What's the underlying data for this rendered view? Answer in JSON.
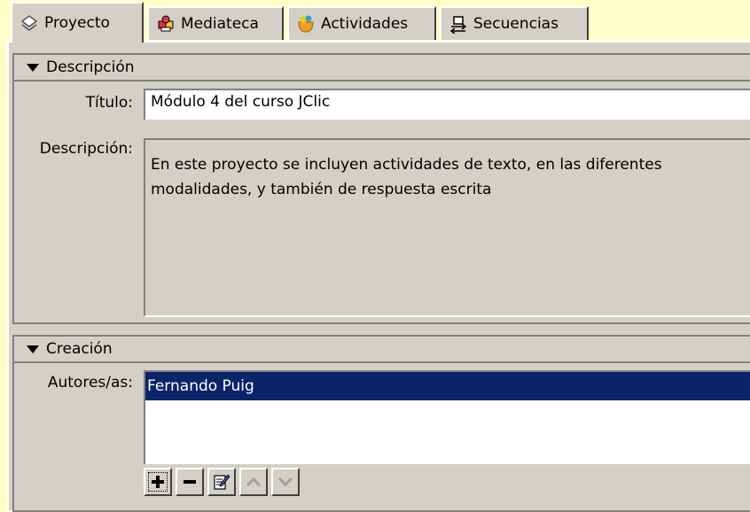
{
  "tabs": [
    {
      "label": "Proyecto",
      "icon": "project-icon",
      "active": true
    },
    {
      "label": "Mediateca",
      "icon": "media-library-icon",
      "active": false
    },
    {
      "label": "Actividades",
      "icon": "activities-icon",
      "active": false
    },
    {
      "label": "Secuencias",
      "icon": "sequences-icon",
      "active": false
    }
  ],
  "descripcion": {
    "header": "Descripción",
    "titulo_label": "Título:",
    "titulo_value": "Módulo 4 del curso JClic",
    "descripcion_label": "Descripción:",
    "descripcion_value": "En este proyecto se incluyen actividades de texto, en las diferentes modalidades, y también de respuesta escrita"
  },
  "creacion": {
    "header": "Creación",
    "autores_label": "Autores/as:",
    "autores": [
      "Fernando Puig"
    ]
  },
  "toolbar": {
    "add_icon": "plus-icon",
    "remove_icon": "minus-icon",
    "edit_icon": "edit-icon",
    "up_icon": "arrow-up-icon",
    "down_icon": "arrow-down-icon"
  },
  "colors": {
    "background": "#fefec8",
    "panel": "#d4d0c8",
    "selection": "#0a246a"
  }
}
